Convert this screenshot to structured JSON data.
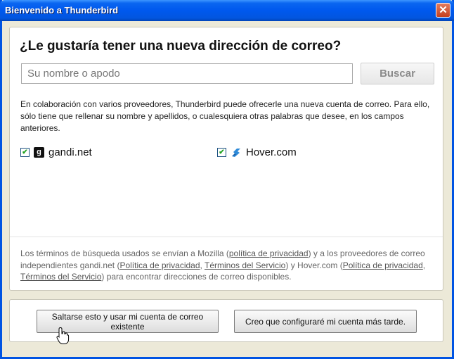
{
  "window": {
    "title": "Bienvenido a Thunderbird",
    "close_label": "✕"
  },
  "main": {
    "heading": "¿Le gustaría tener una nueva dirección de correo?",
    "name_placeholder": "Su nombre o apodo",
    "search_label": "Buscar",
    "description": "En colaboración con varios proveedores, Thunderbird puede ofrecerle una nueva cuenta de correo. Para ello, sólo tiene que rellenar su nombre y apellidos, o cualesquiera otras palabras que desee, en los campos anteriores."
  },
  "providers": [
    {
      "name": "gandi.net",
      "checked": true,
      "icon": "gandi-icon"
    },
    {
      "name": "Hover.com",
      "checked": true,
      "icon": "hover-icon"
    }
  ],
  "footer": {
    "t1": "Los términos de búsqueda usados se envían a Mozilla (",
    "link_mozilla_privacy": "política de privacidad",
    "t2": ") y a los proveedores de correo independientes gandi.net (",
    "link_gandi_privacy": "Política de privacidad",
    "t3": ", ",
    "link_gandi_terms": "Términos del Servicio",
    "t4": ") y Hover.com (",
    "link_hover_privacy": "Política de privacidad",
    "t5": ", ",
    "link_hover_terms": "Términos del Servicio",
    "t6": ") para encontrar direcciones de correo disponibles."
  },
  "buttons": {
    "skip": "Saltarse esto y usar mi cuenta de correo existente",
    "later": "Creo que configuraré mi cuenta más tarde."
  },
  "colors": {
    "titlebar": "#0058ee",
    "check": "#21a121",
    "hover_brand": "#2e8ad8"
  }
}
